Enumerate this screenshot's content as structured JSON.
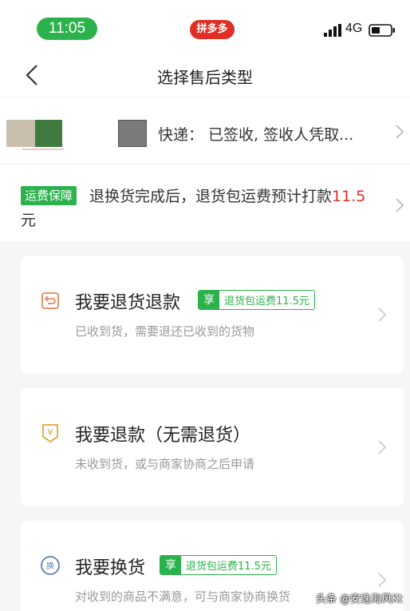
{
  "status_bar": {
    "time": "11:05",
    "app_badge": "拼多多",
    "network": "4G"
  },
  "nav": {
    "title": "选择售后类型"
  },
  "order": {
    "status_text": "快递： 已签收, 签收人凭取..."
  },
  "shipping": {
    "badge": "运费保障",
    "text": "退换货完成后，退货包运费预计打款",
    "amount": "11.5",
    "text_cont": "元"
  },
  "options": [
    {
      "title": "我要退货退款",
      "perk_tag": "享",
      "perk_text": "退货包运费11.5元",
      "subtitle": "已收到货，需要退还已收到的货物",
      "icon": "return-box-icon"
    },
    {
      "title": "我要退款（无需退货）",
      "subtitle": "未收到货，或与商家协商之后申请",
      "icon": "refund-yen-icon"
    },
    {
      "title": "我要换货",
      "perk_tag": "享",
      "perk_text": "退货包运费11.5元",
      "subtitle": "对收到的商品不满意，可与商家协商换货",
      "icon": "exchange-circle-icon"
    }
  ],
  "watermark": "头条 @安逸海风Kt",
  "colors": {
    "brand_green": "#2bb24c",
    "accent_red": "#e02e24"
  }
}
